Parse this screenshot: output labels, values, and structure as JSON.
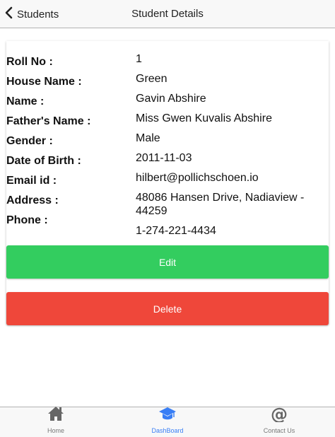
{
  "header": {
    "back_label": "Students",
    "title": "Student Details"
  },
  "details": [
    {
      "label": "Roll No :",
      "value": "1"
    },
    {
      "label": "House Name :",
      "value": "Green"
    },
    {
      "label": "Name :",
      "value": "Gavin Abshire"
    },
    {
      "label": "Father's Name :",
      "value": "Miss Gwen Kuvalis Abshire"
    },
    {
      "label": "Gender :",
      "value": "Male"
    },
    {
      "label": "Date of Birth :",
      "value": "2011-11-03"
    },
    {
      "label": "Email id :",
      "value": "hilbert@pollichschoen.io"
    },
    {
      "label": "Address :",
      "value": "48086 Hansen Drive, Nadiaview - 44259"
    },
    {
      "label": "Phone :",
      "value": "1-274-221-4434"
    }
  ],
  "actions": {
    "edit_label": "Edit",
    "delete_label": "Delete"
  },
  "colors": {
    "edit": "#33cd5f",
    "delete": "#ef473a",
    "active_tab": "#387ef5"
  },
  "tabs": [
    {
      "label": "Home",
      "icon": "home-icon",
      "active": false
    },
    {
      "label": "DashBoard",
      "icon": "graduation-cap-icon",
      "active": true
    },
    {
      "label": "Contact Us",
      "icon": "at-sign-icon",
      "active": false
    }
  ]
}
